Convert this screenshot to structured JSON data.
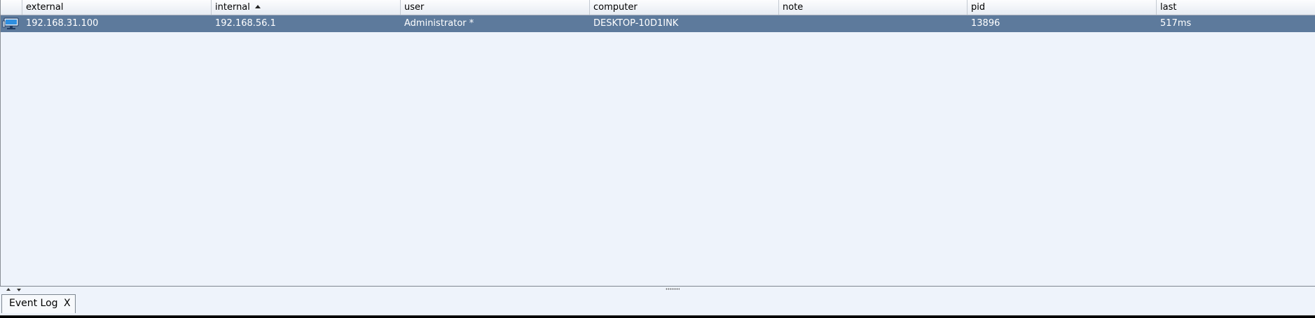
{
  "table": {
    "columns": [
      {
        "label": "external"
      },
      {
        "label": "internal"
      },
      {
        "label": "user"
      },
      {
        "label": "computer"
      },
      {
        "label": "note"
      },
      {
        "label": "pid"
      },
      {
        "label": "last"
      }
    ],
    "sorted_column": "internal",
    "sort_direction": "ascending",
    "rows": [
      {
        "icon": "computer-icon",
        "external": "192.168.31.100",
        "internal": "192.168.56.1",
        "user": "Administrator *",
        "computer": "DESKTOP-10D1INK",
        "note": "",
        "pid": "13896",
        "last": "517ms"
      }
    ],
    "selected_row_color": "#5d7a9c"
  },
  "bottom_panel": {
    "tabs": [
      {
        "label": "Event Log",
        "close_label": "X"
      }
    ]
  }
}
